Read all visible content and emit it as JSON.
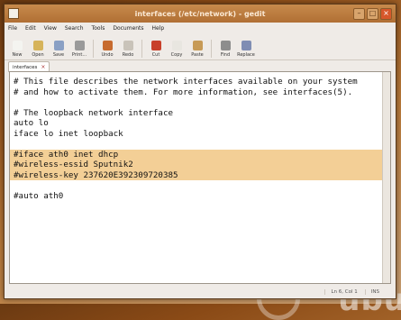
{
  "window": {
    "title": "interfaces (/etc/network) - gedit"
  },
  "menubar": [
    "File",
    "Edit",
    "View",
    "Search",
    "Tools",
    "Documents",
    "Help"
  ],
  "toolbar": [
    {
      "label": "New",
      "icon": "new-file-icon",
      "color": "#f4f4f0"
    },
    {
      "label": "Open",
      "icon": "open-folder-icon",
      "color": "#d6b35a"
    },
    {
      "label": "Save",
      "icon": "save-icon",
      "color": "#8aa0c4"
    },
    {
      "label": "Print...",
      "icon": "print-icon",
      "color": "#9a9a9a"
    },
    {
      "label": "Undo",
      "icon": "undo-icon",
      "color": "#c76b2e"
    },
    {
      "label": "Redo",
      "icon": "redo-icon",
      "color": "#c9c3b9"
    },
    {
      "label": "Cut",
      "icon": "cut-icon",
      "color": "#c8402a"
    },
    {
      "label": "Copy",
      "icon": "copy-icon",
      "color": "#e8e6e0"
    },
    {
      "label": "Paste",
      "icon": "paste-icon",
      "color": "#c79a56"
    },
    {
      "label": "Find",
      "icon": "find-icon",
      "color": "#8d8d8d"
    },
    {
      "label": "Replace",
      "icon": "replace-icon",
      "color": "#7f8db3"
    }
  ],
  "tab": {
    "label": "interfaces",
    "close": "×"
  },
  "editor": {
    "lines": [
      "# This file describes the network interfaces available on your system",
      "# and how to activate them. For more information, see interfaces(5).",
      "",
      "# The loopback network interface",
      "auto lo",
      "iface lo inet loopback",
      "",
      "#iface ath0 inet dhcp",
      "#wireless-essid Sputnik2",
      "#wireless-key 237620E392309720385",
      "",
      "#auto ath0"
    ],
    "highlighted_lines": [
      7,
      8,
      9
    ]
  },
  "statusbar": {
    "position": "Ln 6, Col 1",
    "mode": "INS"
  },
  "desktop": {
    "watermark": "ubu"
  }
}
